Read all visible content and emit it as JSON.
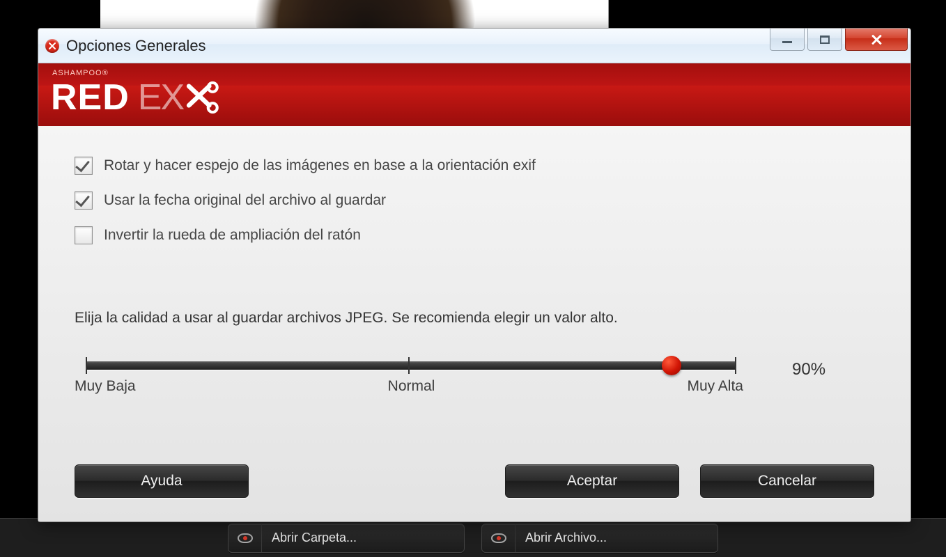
{
  "window": {
    "title": "Opciones Generales"
  },
  "brand": {
    "vendor": "ASHAMPOO®",
    "name_part1": "RED",
    "name_part2": "EX"
  },
  "options": {
    "rotate_exif": {
      "label": "Rotar y hacer espejo de las imágenes en base a la orientación exif",
      "checked": true
    },
    "use_orig_date": {
      "label": "Usar la fecha original del archivo al guardar",
      "checked": true
    },
    "invert_wheel": {
      "label": "Invertir la rueda de ampliación del ratón",
      "checked": false
    }
  },
  "quality": {
    "instruction": "Elija la calidad a usar al guardar archivos JPEG. Se recomienda elegir un valor alto.",
    "low_label": "Muy Baja",
    "mid_label": "Normal",
    "high_label": "Muy Alta",
    "value_percent": 90,
    "value_display": "90%"
  },
  "buttons": {
    "help": "Ayuda",
    "ok": "Aceptar",
    "cancel": "Cancelar"
  },
  "background_toolbar": {
    "open_folder": "Abrir Carpeta...",
    "open_file": "Abrir Archivo..."
  }
}
